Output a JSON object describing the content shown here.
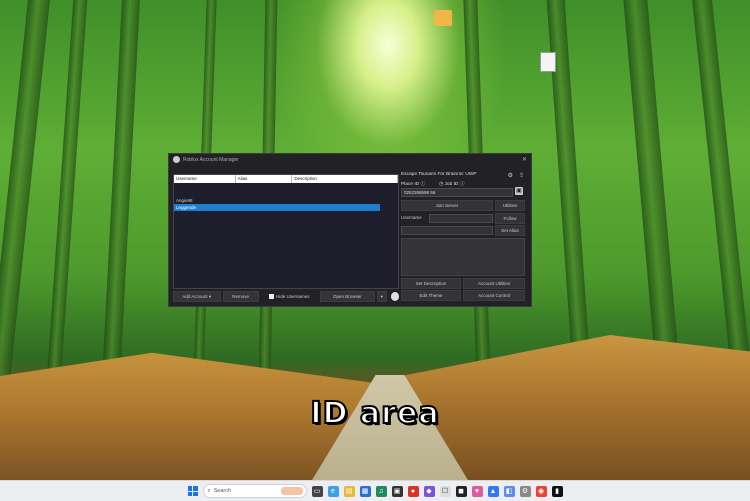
{
  "window": {
    "title": "Roblox Account Manager",
    "close_glyph": "✕"
  },
  "accounts": {
    "columns": [
      "Username",
      "Alias",
      "Description"
    ],
    "rows": [
      {
        "username": "Angie88",
        "selected": false
      },
      {
        "username": "Leggende",
        "selected": true
      }
    ]
  },
  "bottom_bar": {
    "add_account": "Add Account ▾",
    "remove": "Remove",
    "hide_usernames": "Hide Usernames",
    "open_browser": "Open Browser",
    "dropdown_glyph": "▾"
  },
  "game": {
    "title": "Escape Tsunami For Brainrot: UWP",
    "place_label": "Place ID",
    "job_label": "Job ID",
    "place_id_value": "0252266598 56"
  },
  "right_buttons": {
    "join_server": "Join Server",
    "utilities": "Utilities",
    "username_label": "Username",
    "follow": "Follow",
    "set_alias": "Set Alias",
    "set_description": "Set Description",
    "account_utilities": "Account Utilities",
    "edit_theme": "Edit Theme",
    "account_control": "Account Control"
  },
  "caption": "ID area",
  "taskbar": {
    "search_placeholder": "Search"
  },
  "colors": {
    "selection": "#1d7fce",
    "window_bg": "#222226"
  }
}
